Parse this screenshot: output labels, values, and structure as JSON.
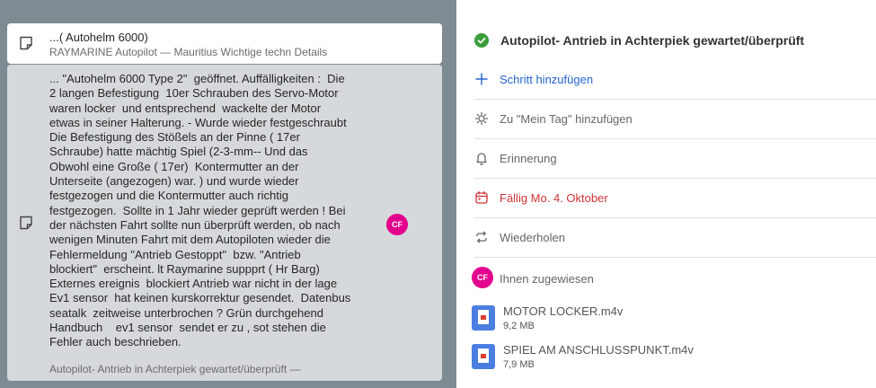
{
  "list": {
    "items": [
      {
        "title": "...( Autohelm 6000)",
        "subtitle": "RAYMARINE Autopilot — Mauritius Wichtige techn Details"
      },
      {
        "body": "... \"Autohelm 6000 Type 2\"  geöffnet. Auffälligkeiten :  Die\n2 langen Befestigung  10er Schrauben des Servo-Motor\nwaren locker  und entsprechend  wackelte der Motor\netwas in seiner Halterung. - Wurde wieder festgeschraubt\nDie Befestigung des Stößels an der Pinne ( 17er\nSchraube) hatte mächtig Spiel (2-3-mm-- Und das\nObwohl eine Große ( 17er)  Kontermutter an der\nUnterseite (angezogen) war. ) und wurde wieder\nfestgezogen und die Kontermutter auch richtig\nfestgezogen.  Sollte in 1 Jahr wieder geprüft werden ! Bei\nder nächsten Fahrt sollte nun überprüft werden, ob nach\nwenigen Minuten Fahrt mit dem Autopiloten wieder die\nFehlermeldung \"Antrieb Gestoppt\"  bzw. \"Antrieb\nblockiert\"  erscheint. lt Raymarine suppprt ( Hr Barg)\nExternes ereignis  blockiert Antrieb war nicht in der lage\nEv1 sensor  hat keinen kurskorrektur gesendet.  Datenbus\nseatalk  zeitweise unterbrochen ? Grün durchgehend\nHandbuch    ev1 sensor  sendet er zu , sot stehen die\nFehler auch beschrieben.",
        "subtitle": "Autopilot- Antrieb in Achterpiek gewartet/überprüft —",
        "avatar": "CF"
      }
    ]
  },
  "detail": {
    "task_title": "Autopilot- Antrieb in Achterpiek gewartet/überprüft",
    "add_step": "Schritt hinzufügen",
    "my_day": "Zu \"Mein Tag\" hinzufügen",
    "reminder": "Erinnerung",
    "due": "Fällig Mo. 4. Oktober",
    "repeat": "Wiederholen",
    "assigned_avatar": "CF",
    "assigned": "Ihnen zugewiesen",
    "files": [
      {
        "name": "MOTOR LOCKER.m4v",
        "size": "9,2 MB"
      },
      {
        "name": "SPIEL AM ANSCHLUSSPUNKT.m4v",
        "size": "7,9 MB"
      }
    ]
  },
  "colors": {
    "accent_blue": "#2564cf",
    "due_red": "#d13438",
    "check_green": "#3a9d3a",
    "avatar_pink": "#e3008c",
    "file_blue": "#4a7ee0"
  }
}
